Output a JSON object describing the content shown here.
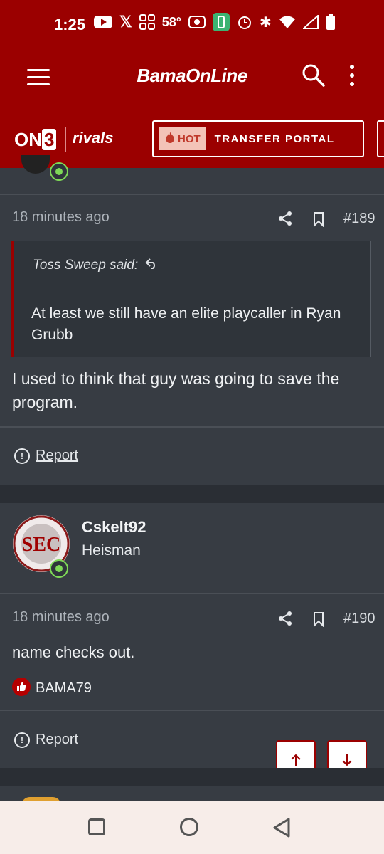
{
  "status_bar": {
    "time": "1:25",
    "temperature": "58°",
    "icons": [
      "youtube-icon",
      "x-icon",
      "grid-icon",
      "temperature",
      "camera-icon",
      "battery-saver-icon",
      "alarm-icon",
      "bluetooth-icon",
      "wifi-icon",
      "signal-icon",
      "battery-icon"
    ]
  },
  "app_bar": {
    "logo": "BamaOnLine"
  },
  "sub_bar": {
    "on3_prefix": "ON",
    "on3_box": "3",
    "rivals": "rivals",
    "hot_label": "HOT",
    "transfer_label": "TRANSFER PORTAL"
  },
  "post189": {
    "time": "18 minutes ago",
    "number": "#189",
    "quote_author": "Toss Sweep said:",
    "quote_text": "At least we still have an elite playcaller in Ryan Grubb",
    "body": "I used to think that guy was going to save the program.",
    "report": "Report"
  },
  "post190": {
    "username": "Cskelt92",
    "title": "Heisman",
    "avatar_text": "SEC",
    "time": "18 minutes ago",
    "number": "#190",
    "body": "name checks out.",
    "reaction_user": "BAMA79",
    "report": "Report"
  },
  "colors": {
    "brand_red": "#9b0000",
    "online_green": "#7ed957",
    "post_bg": "#373c43"
  }
}
